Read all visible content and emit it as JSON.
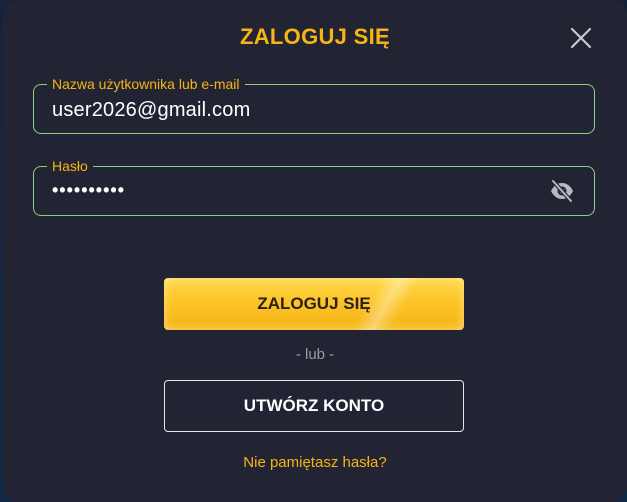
{
  "modal": {
    "title": "ZALOGUJ SIĘ",
    "close_icon": "close-icon"
  },
  "username_field": {
    "label": "Nazwa użytkownika lub e-mail",
    "value": "user2026@gmail.com"
  },
  "password_field": {
    "label": "Hasło",
    "value_masked": "••••••••••",
    "toggle_icon": "eye-slash-icon"
  },
  "actions": {
    "login_label": "ZALOGUJ SIĘ",
    "or_label": "- lub -",
    "create_account_label": "UTWÓRZ KONTO",
    "forgot_password_label": "Nie pamiętasz hasła?"
  },
  "colors": {
    "accent": "#f7b515",
    "field_border": "#8fcf82",
    "modal_bg": "#222433"
  }
}
